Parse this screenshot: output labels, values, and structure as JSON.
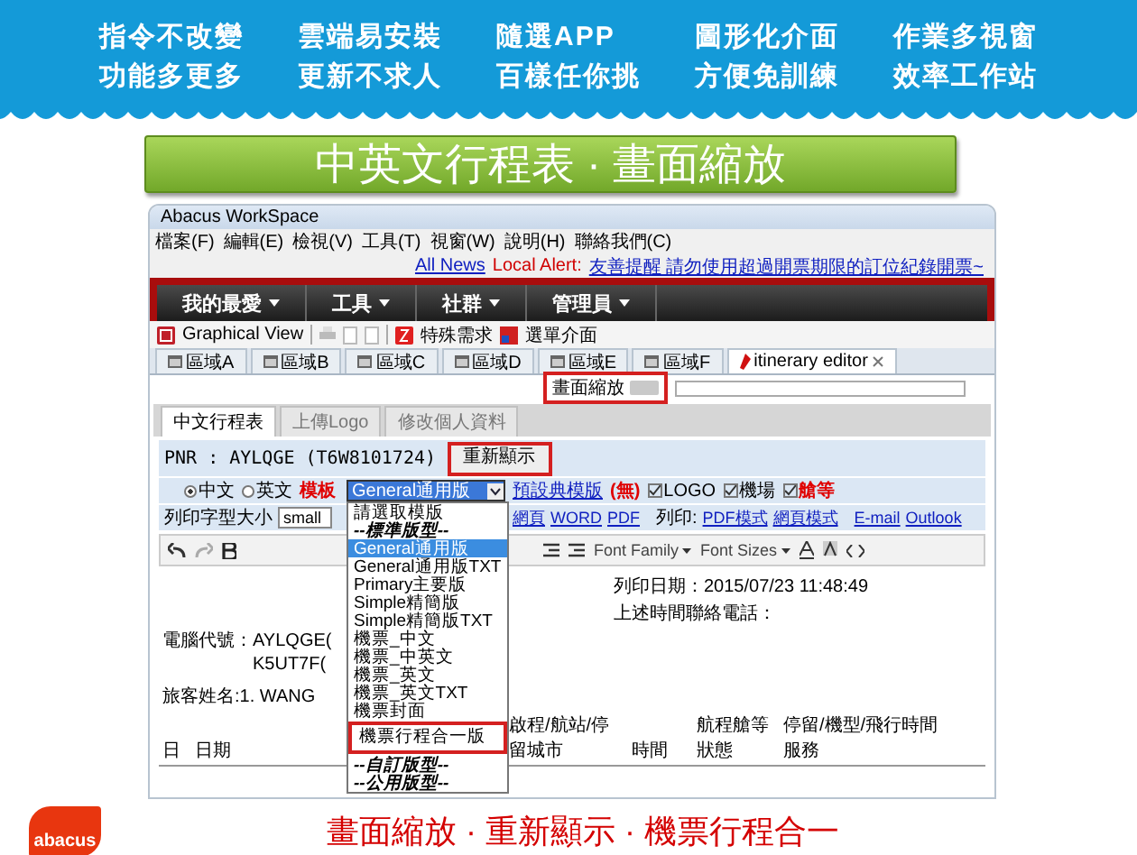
{
  "banner": [
    {
      "line1": "指令不改變",
      "line2": "功能多更多"
    },
    {
      "line1": "雲端易安裝",
      "line2": "更新不求人"
    },
    {
      "line1": "隨選APP",
      "line2": "百樣任你挑"
    },
    {
      "line1": "圖形化介面",
      "line2": "方便免訓練"
    },
    {
      "line1": "作業多視窗",
      "line2": "效率工作站"
    }
  ],
  "title": "中英文行程表 · 畫面縮放",
  "app": {
    "window_title": "Abacus WorkSpace",
    "menu": [
      "檔案(F)",
      "編輯(E)",
      "檢視(V)",
      "工具(T)",
      "視窗(W)",
      "說明(H)",
      "聯絡我們(C)"
    ],
    "news_link": "All News",
    "alert_label": "Local Alert:",
    "alert_text": "友善提醒 請勿使用超過開票期限的訂位紀錄開票~",
    "nav": [
      "我的最愛",
      "工具",
      "社群",
      "管理員"
    ],
    "toolbar": {
      "graphical_view": "Graphical View",
      "special": "特殊需求",
      "menu_ui": "選單介面"
    },
    "tabs": [
      {
        "label": "區域A",
        "kind": "region",
        "selected": false
      },
      {
        "label": "區域B",
        "kind": "region",
        "selected": false
      },
      {
        "label": "區域C",
        "kind": "region",
        "selected": false
      },
      {
        "label": "區域D",
        "kind": "region",
        "selected": false
      },
      {
        "label": "區域E",
        "kind": "region",
        "selected": false
      },
      {
        "label": "區域F",
        "kind": "region",
        "selected": false
      },
      {
        "label": "itinerary editor",
        "kind": "editor",
        "selected": true
      }
    ],
    "zoom": {
      "label": "畫面縮放",
      "on": false,
      "highlighted": true
    },
    "inner_tabs": [
      {
        "label": "中文行程表",
        "selected": true
      },
      {
        "label": "上傳Logo",
        "selected": false
      },
      {
        "label": "修改個人資料",
        "selected": false
      }
    ],
    "pnr": "PNR : AYLQGE (T6W8101724)",
    "refresh_button": {
      "label": "重新顯示",
      "highlighted": true
    },
    "languages": [
      {
        "label": "中文",
        "selected": true
      },
      {
        "label": "英文",
        "selected": false
      }
    ],
    "template_label": "模板",
    "template_value": "General通用版",
    "preview_link": "預設典模版",
    "preview_suffix": "(無)",
    "checks": [
      {
        "label": "LOGO",
        "checked": true,
        "kind": "plain"
      },
      {
        "label": "機場",
        "checked": true,
        "kind": "plain"
      },
      {
        "label": "艙等",
        "checked": true,
        "kind": "warning"
      }
    ],
    "print_size_label": "列印字型大小",
    "print_size_value": "small",
    "export_links": [
      "網頁",
      "WORD",
      "PDF"
    ],
    "print_label": "列印:",
    "print_links": [
      "PDF模式",
      "網頁模式"
    ],
    "mail_links": [
      "E-mail",
      "Outlook"
    ],
    "editor_tools": {
      "font_family": "Font Family",
      "font_sizes": "Font Sizes"
    },
    "dropdown": [
      {
        "label": "請選取模版",
        "kind": "option",
        "selected": false,
        "highlighted": false
      },
      {
        "label": "--標準版型--",
        "kind": "group",
        "selected": false,
        "highlighted": false
      },
      {
        "label": "General通用版",
        "kind": "option",
        "selected": true,
        "highlighted": false
      },
      {
        "label": "General通用版TXT",
        "kind": "option",
        "selected": false,
        "highlighted": false
      },
      {
        "label": "Primary主要版",
        "kind": "option",
        "selected": false,
        "highlighted": false
      },
      {
        "label": "Simple精簡版",
        "kind": "option",
        "selected": false,
        "highlighted": false
      },
      {
        "label": "Simple精簡版TXT",
        "kind": "option",
        "selected": false,
        "highlighted": false
      },
      {
        "label": "機票_中文",
        "kind": "option",
        "selected": false,
        "highlighted": false
      },
      {
        "label": "機票_中英文",
        "kind": "option",
        "selected": false,
        "highlighted": false
      },
      {
        "label": "機票_英文",
        "kind": "option",
        "selected": false,
        "highlighted": false
      },
      {
        "label": "機票_英文TXT",
        "kind": "option",
        "selected": false,
        "highlighted": false
      },
      {
        "label": "機票封面",
        "kind": "option",
        "selected": false,
        "highlighted": false
      },
      {
        "label": "機票行程合一版",
        "kind": "option",
        "selected": false,
        "highlighted": true
      },
      {
        "label": "--自訂版型--",
        "kind": "group",
        "selected": false,
        "highlighted": false
      },
      {
        "label": "--公用版型--",
        "kind": "group",
        "selected": false,
        "highlighted": false
      }
    ],
    "document": {
      "print_date": "列印日期：2015/07/23 11:48:49",
      "contact": "上述時間聯絡電話：",
      "record_code": "電腦代號：AYLQGE(",
      "record_code_2": "K5UT7F(",
      "passenger": "旅客姓名:1. WANG",
      "columns": [
        "日",
        "日期",
        "啟程/航站/停留城市",
        "時間",
        "航程艙等狀態",
        "停留/機型/飛行時間服務"
      ]
    }
  },
  "caption": "畫面縮放 · 重新顯示 · 機票行程合一",
  "logo": "abacus"
}
